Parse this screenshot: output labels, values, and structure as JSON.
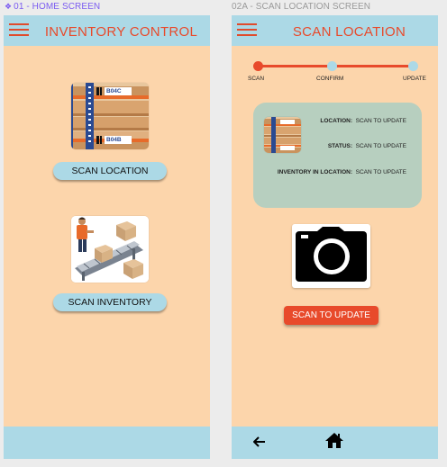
{
  "frames": {
    "home": {
      "label": "01 - HOME SCREEN",
      "title": "INVENTORY CONTROL",
      "buttons": {
        "scan_location": "SCAN LOCATION",
        "scan_inventory": "SCAN INVENTORY"
      },
      "shelf_labels": [
        "B04C",
        "B04B"
      ]
    },
    "scan_location": {
      "label": "02A - SCAN LOCATION SCREEN",
      "title": "SCAN LOCATION",
      "steps": [
        {
          "label": "SCAN",
          "active": true
        },
        {
          "label": "CONFIRM",
          "active": false
        },
        {
          "label": "UPDATE",
          "active": false
        }
      ],
      "info": {
        "location_label": "LOCATION:",
        "location_value": "SCAN TO UPDATE",
        "status_label": "STATUS:",
        "status_value": "SCAN TO UPDATE",
        "inventory_label": "INVENTORY IN LOCATION:",
        "inventory_value": "SCAN TO UPDATE"
      },
      "scan_button": "SCAN TO UPDATE",
      "icons": {
        "back": "arrow-left-icon",
        "home": "home-icon",
        "camera": "camera-icon",
        "menu": "hamburger-menu-icon"
      }
    }
  },
  "colors": {
    "screen_bg": "#fcd5ab",
    "bar_bg": "#acd9e6",
    "accent": "#e84a2b",
    "card_bg": "#b7cfbf",
    "step_inactive": "#acd9e6",
    "frame_label_active": "#7b5cf0"
  }
}
